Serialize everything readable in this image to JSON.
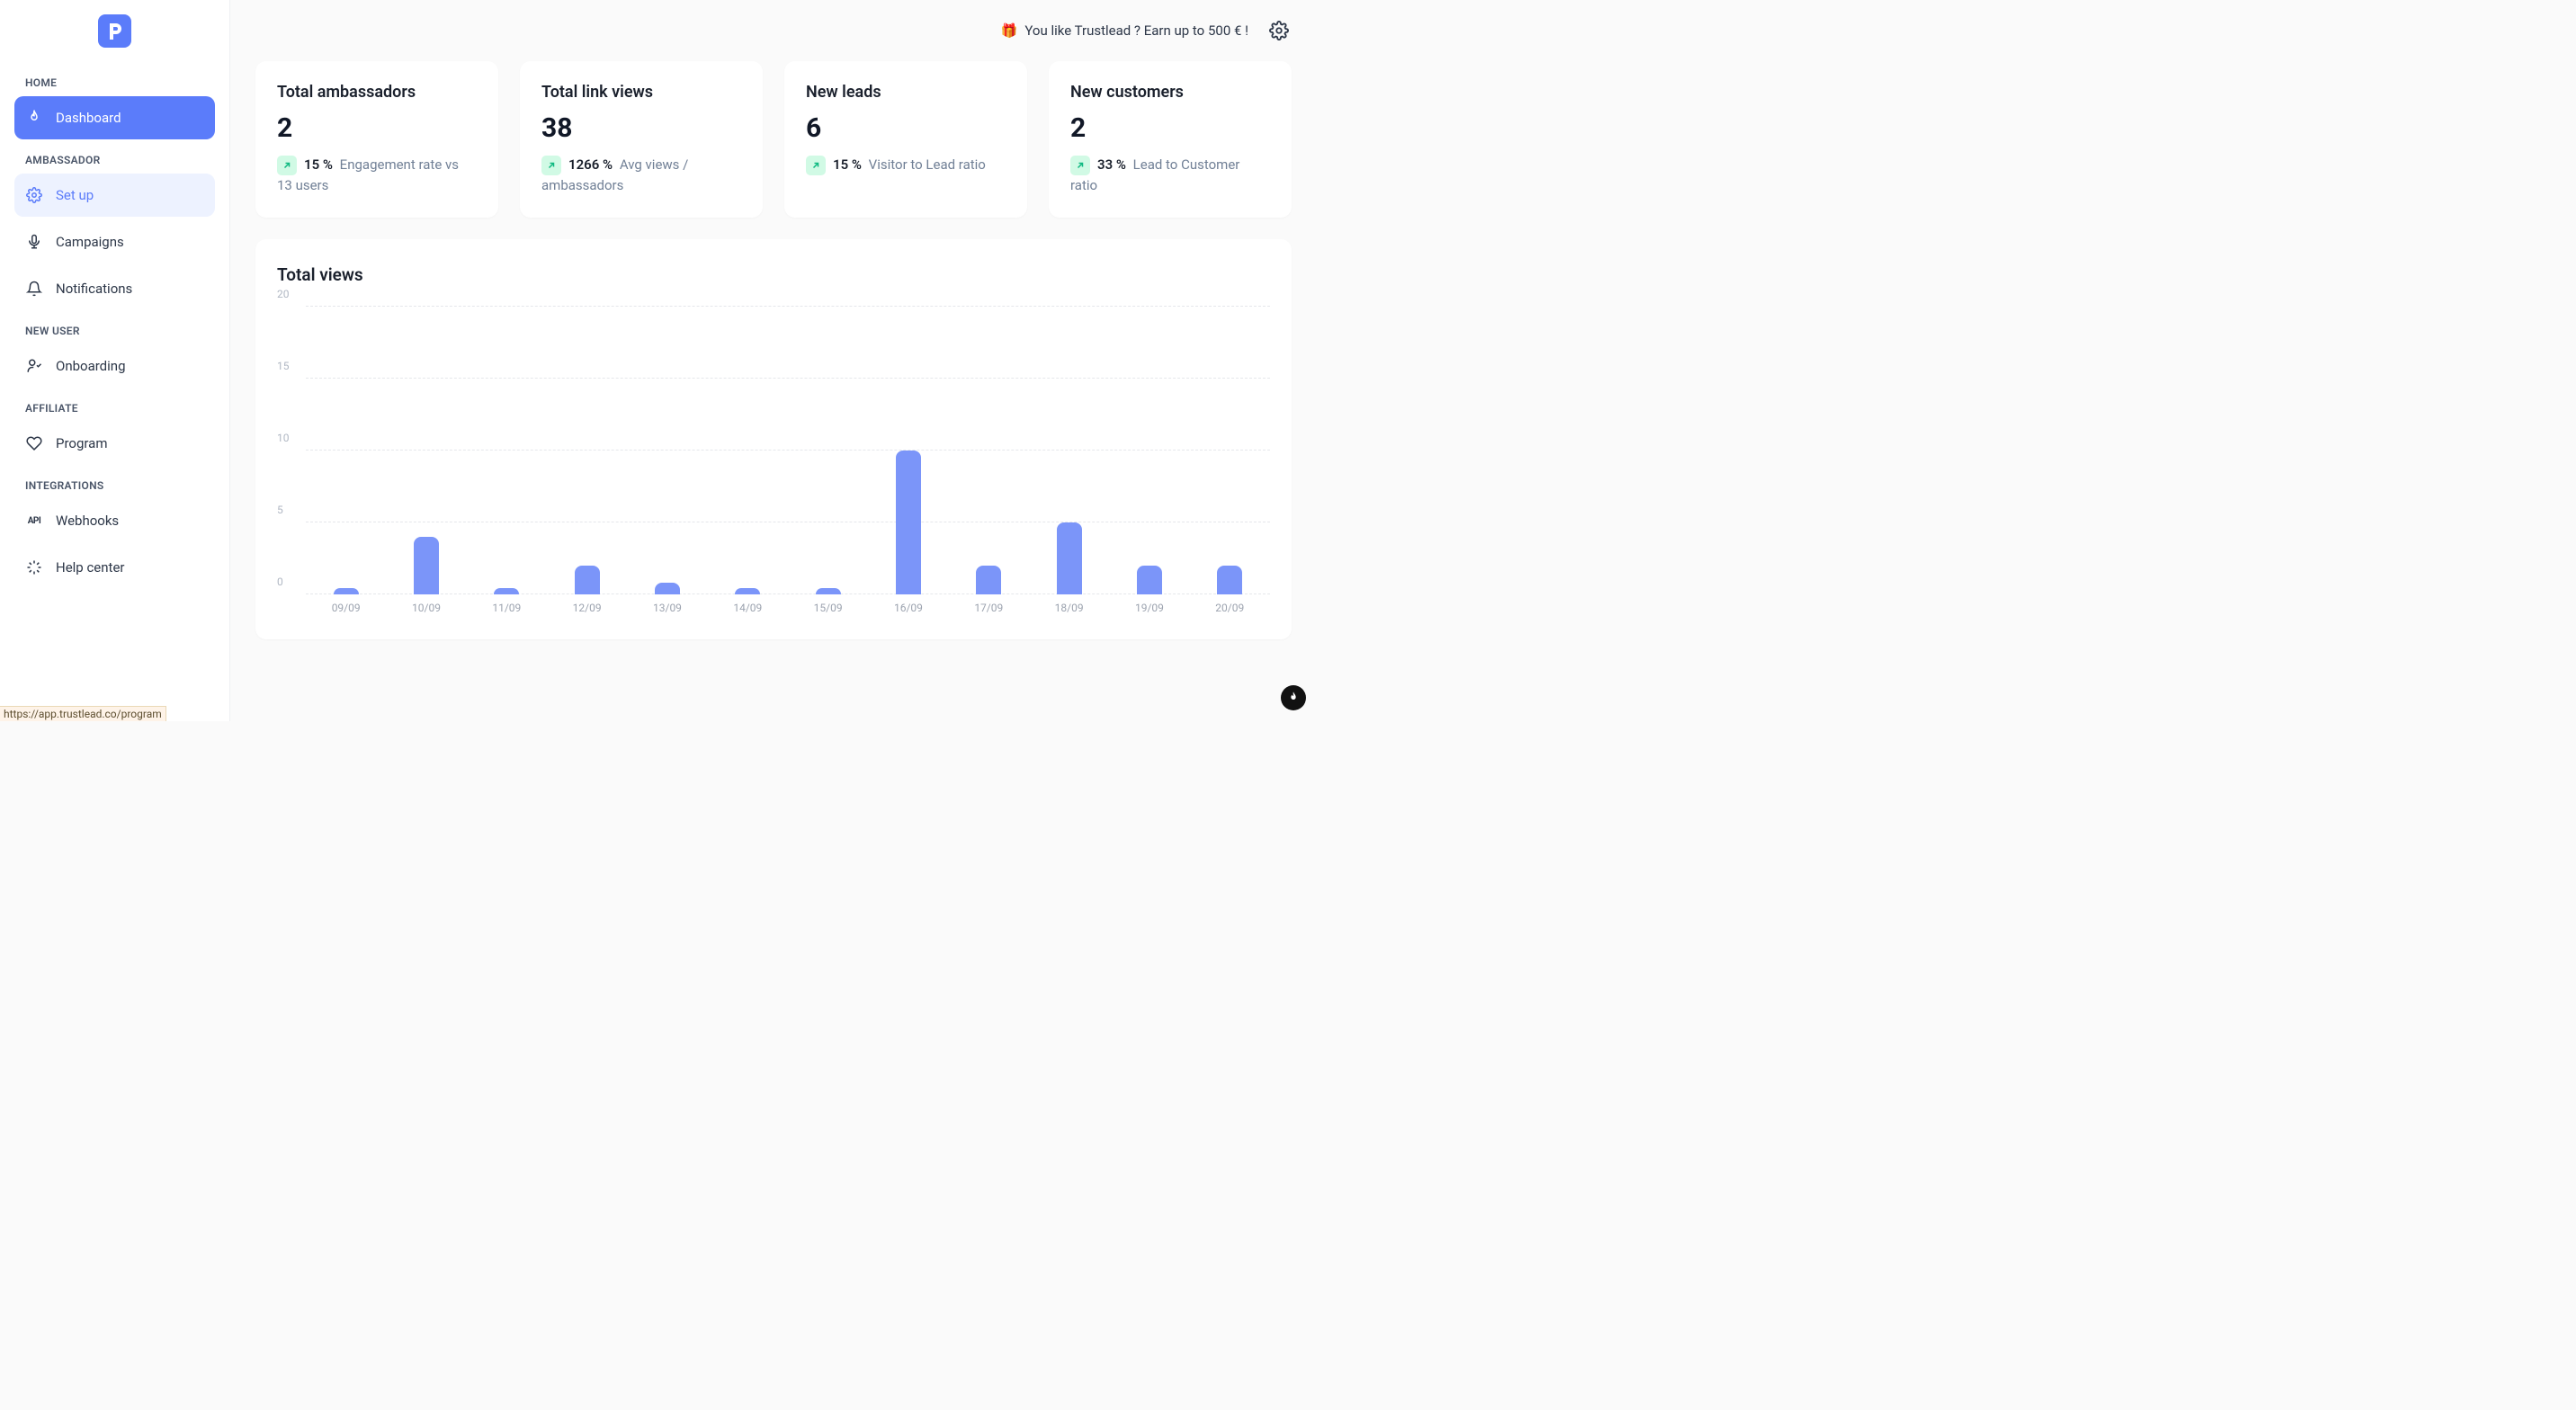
{
  "colors": {
    "primary": "#5b7cfa",
    "bar": "#7b95f9",
    "upBg": "#d1fae5",
    "upFg": "#10b981"
  },
  "logo_letter": "P",
  "promo": "You like Trustlead ? Earn up to 500 € !",
  "sidebar": {
    "sections": [
      {
        "label": "HOME",
        "items": [
          {
            "id": "dashboard",
            "label": "Dashboard",
            "active": "primary"
          }
        ]
      },
      {
        "label": "AMBASSADOR",
        "items": [
          {
            "id": "setup",
            "label": "Set up",
            "active": "light"
          },
          {
            "id": "campaigns",
            "label": "Campaigns"
          },
          {
            "id": "notifications",
            "label": "Notifications"
          }
        ]
      },
      {
        "label": "NEW USER",
        "items": [
          {
            "id": "onboarding",
            "label": "Onboarding"
          }
        ]
      },
      {
        "label": "AFFILIATE",
        "items": [
          {
            "id": "program",
            "label": "Program"
          }
        ]
      },
      {
        "label": "INTEGRATIONS",
        "items": [
          {
            "id": "webhooks",
            "label": "Webhooks"
          },
          {
            "id": "helpcenter",
            "label": "Help center"
          }
        ]
      }
    ]
  },
  "cards": [
    {
      "title": "Total ambassadors",
      "value": "2",
      "pct": "15 %",
      "desc": "Engagement rate vs 13 users"
    },
    {
      "title": "Total link views",
      "value": "38",
      "pct": "1266 %",
      "desc": "Avg views / ambassadors"
    },
    {
      "title": "New leads",
      "value": "6",
      "pct": "15 %",
      "desc": "Visitor to Lead ratio"
    },
    {
      "title": "New customers",
      "value": "2",
      "pct": "33 %",
      "desc": "Lead to Customer ratio"
    }
  ],
  "chart_data": {
    "type": "bar",
    "title": "Total views",
    "categories": [
      "09/09",
      "10/09",
      "11/09",
      "12/09",
      "13/09",
      "14/09",
      "15/09",
      "16/09",
      "17/09",
      "18/09",
      "19/09",
      "20/09"
    ],
    "values": [
      0.4,
      4,
      0.4,
      2,
      0.8,
      0.4,
      0.4,
      10,
      2,
      5,
      2,
      2
    ],
    "ylim": [
      0,
      20
    ],
    "yticks": [
      0,
      5,
      10,
      15,
      20
    ],
    "xlabel": "",
    "ylabel": ""
  },
  "status_url": "https://app.trustlead.co/program"
}
